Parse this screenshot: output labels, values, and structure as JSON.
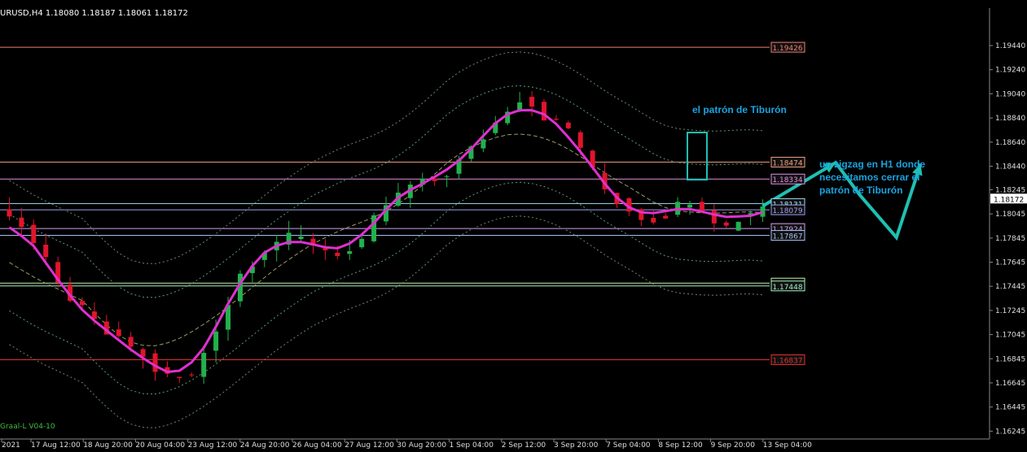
{
  "header": {
    "symbol_info": "URUSD,H4  1.18080 1.18187 1.18061 1.18172"
  },
  "indicator_label": "Graal-L V04-10",
  "annotations": {
    "pattern_title": "el patrón de Tiburón",
    "zigzag_note": [
      "un zigzag en H1 donde",
      "necesitamos cerrar el",
      "patrón de Tiburón"
    ]
  },
  "colors": {
    "background": "#000000",
    "bull_candle": "#22b14c",
    "bear_candle": "#e0152b",
    "ma_line": "#e030d0",
    "zigzag_arrow": "#1fbfb3",
    "annotation_text": "#1aa3e0",
    "axis_text": "#dddddd"
  },
  "chart_data": {
    "type": "candlestick",
    "symbol": "EURUSD",
    "timeframe": "H4",
    "current_price": 1.18172,
    "ylim": [
      1.1618,
      1.1975
    ],
    "price_axis_ticks": [
      "1.19440",
      "1.19240",
      "1.19040",
      "1.18840",
      "1.18640",
      "1.18440",
      "1.18245",
      "1.18045",
      "1.17845",
      "1.17645",
      "1.17445",
      "1.17245",
      "1.17045",
      "1.16845",
      "1.16645",
      "1.16445",
      "1.16245"
    ],
    "time_axis_labels": [
      "2021",
      "17 Aug 12:00",
      "18 Aug 20:00",
      "20 Aug 04:00",
      "23 Aug 12:00",
      "24 Aug 20:00",
      "26 Aug 04:00",
      "27 Aug 12:00",
      "30 Aug 20:00",
      "1 Sep 04:00",
      "2 Sep 12:00",
      "3 Sep 20:00",
      "7 Sep 04:00",
      "8 Sep 12:00",
      "9 Sep 20:00",
      "13 Sep 04:00"
    ],
    "horizontal_levels": [
      {
        "price": 1.19426,
        "label": "1.19426",
        "color": "#f08070"
      },
      {
        "price": 1.18474,
        "label": "1.18474",
        "color": "#f0a080"
      },
      {
        "price": 1.18334,
        "label": "1.18334",
        "color": "#e090e0"
      },
      {
        "price": 1.18131,
        "label": "1.18131",
        "color": "#a0e0f0"
      },
      {
        "price": 1.18079,
        "label": "1.18079",
        "color": "#a0a0f0"
      },
      {
        "price": 1.17924,
        "label": "1.17924",
        "color": "#d0a0f0"
      },
      {
        "price": 1.17867,
        "label": "1.17867",
        "color": "#a0c0f0"
      },
      {
        "price": 1.17472,
        "label": "1.17472",
        "color": "#c0f0a0"
      },
      {
        "price": 1.17448,
        "label": "1.17448",
        "color": "#a0f0c0"
      },
      {
        "price": 1.16837,
        "label": "1.16837",
        "color": "#e03030"
      }
    ],
    "price_path": [
      1.1805,
      1.1795,
      1.178,
      1.1765,
      1.1745,
      1.1735,
      1.1725,
      1.1715,
      1.1705,
      1.17,
      1.1695,
      1.1685,
      1.1675,
      1.167,
      1.1668,
      1.167,
      1.169,
      1.171,
      1.173,
      1.1755,
      1.1765,
      1.1775,
      1.1782,
      1.1785,
      1.1784,
      1.178,
      1.1775,
      1.1772,
      1.1773,
      1.178,
      1.18,
      1.1812,
      1.182,
      1.1828,
      1.183,
      1.1832,
      1.1838,
      1.1848,
      1.1858,
      1.1868,
      1.188,
      1.1892,
      1.19,
      1.1895,
      1.1885,
      1.188,
      1.1875,
      1.186,
      1.184,
      1.1825,
      1.1815,
      1.1808,
      1.1802,
      1.18,
      1.1804,
      1.1812,
      1.1816,
      1.181,
      1.18,
      1.1794,
      1.18,
      1.1806,
      1.1812
    ],
    "zigzag_points": [
      [
        62,
        1.1811
      ],
      [
        68,
        1.1847
      ],
      [
        70,
        1.182
      ],
      [
        73,
        1.1785
      ],
      [
        75,
        1.1846
      ]
    ]
  }
}
